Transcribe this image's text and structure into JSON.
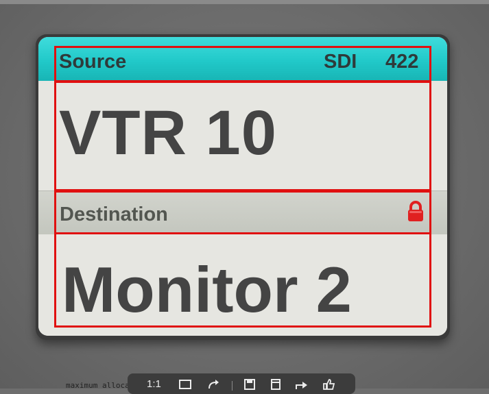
{
  "source": {
    "label": "Source",
    "format": "SDI",
    "sampling": "422",
    "name": "VTR 10"
  },
  "destination": {
    "label": "Destination",
    "name": "Monitor 2",
    "lock_icon": "lock-icon"
  },
  "status_line": "maximum allocated memory: 20760",
  "toolbar": {
    "zoom_label": "1:1",
    "icons": [
      "fit-icon",
      "rotate-icon",
      "save-icon",
      "copy-icon",
      "share-icon",
      "like-icon"
    ]
  },
  "colors": {
    "source_header": "#21c9c9",
    "destination_header": "#c3c6be",
    "lock": "#e02020",
    "highlight": "#e01010"
  }
}
